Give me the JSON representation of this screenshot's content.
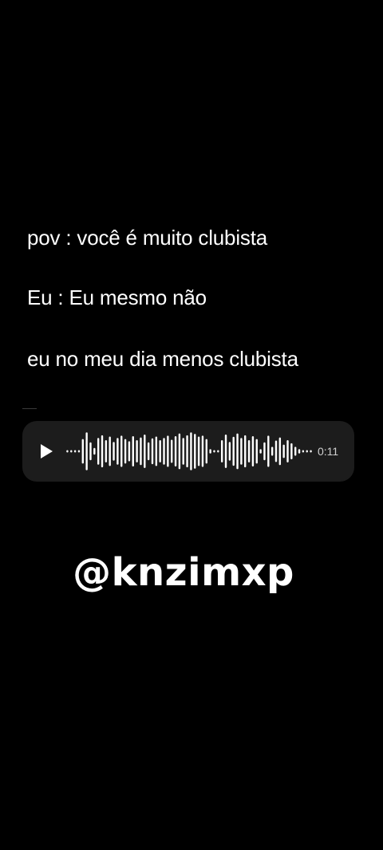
{
  "captions": {
    "line1": "pov : você é muito clubista",
    "line2": "Eu : Eu mesmo não",
    "line3": "eu no meu dia menos clubista"
  },
  "voice_message": {
    "play_icon": "play-icon",
    "duration": "0:11",
    "waveform_levels": [
      0.03,
      0.03,
      0.03,
      0.03,
      0.55,
      0.85,
      0.4,
      0.15,
      0.6,
      0.72,
      0.5,
      0.66,
      0.42,
      0.6,
      0.7,
      0.55,
      0.45,
      0.68,
      0.5,
      0.62,
      0.75,
      0.4,
      0.58,
      0.66,
      0.5,
      0.6,
      0.7,
      0.52,
      0.68,
      0.8,
      0.6,
      0.72,
      0.85,
      0.78,
      0.66,
      0.7,
      0.55,
      0.1,
      0.03,
      0.03,
      0.5,
      0.75,
      0.42,
      0.65,
      0.8,
      0.6,
      0.72,
      0.5,
      0.68,
      0.55,
      0.1,
      0.4,
      0.7,
      0.2,
      0.48,
      0.62,
      0.3,
      0.5,
      0.36,
      0.2,
      0.1,
      0.03,
      0.03,
      0.03
    ],
    "bubble_color": "#1c1c1c",
    "wave_color": "#ffffff"
  },
  "handle": "@knzimxp",
  "background_color": "#000000"
}
